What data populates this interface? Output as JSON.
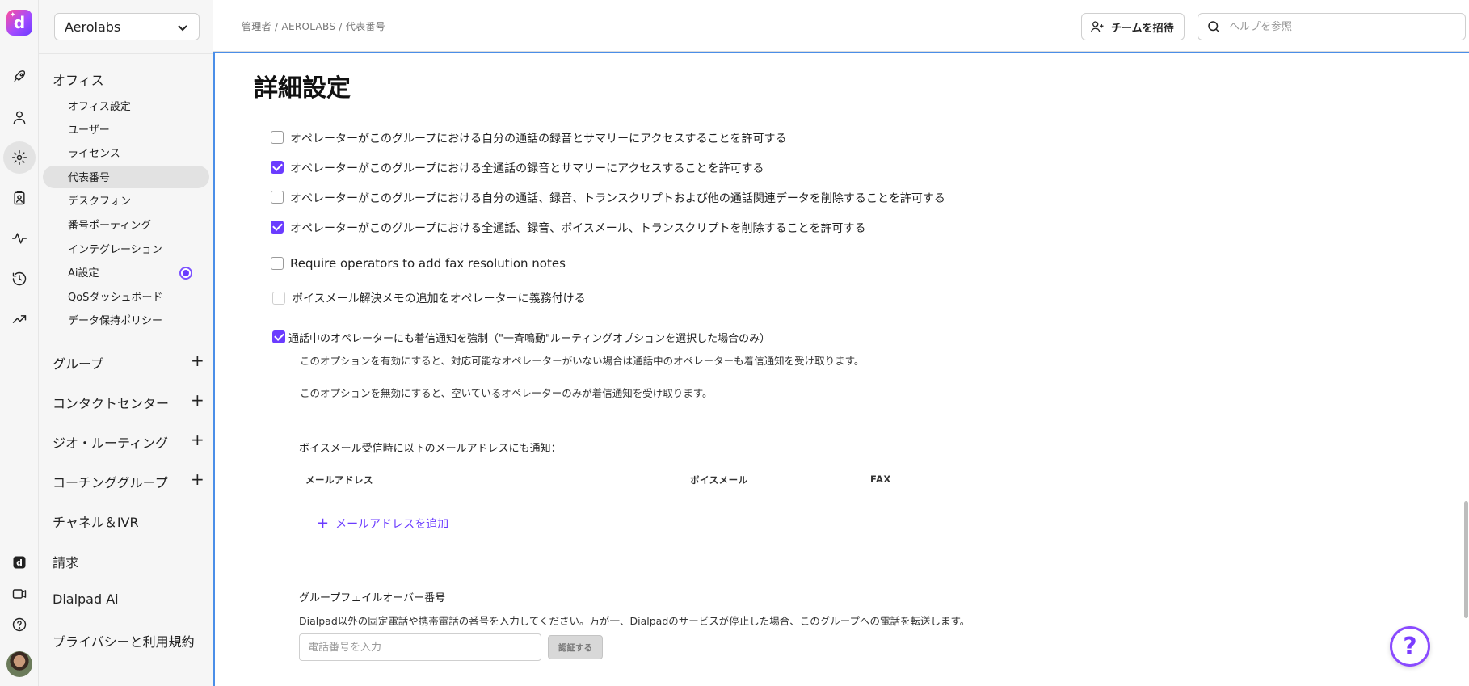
{
  "app": {
    "logo_letter": "d"
  },
  "sidebar": {
    "org_name": "Aerolabs",
    "sections": [
      {
        "label": "オフィス",
        "expanded": true
      },
      {
        "label": "グループ"
      },
      {
        "label": "コンタクトセンター"
      },
      {
        "label": "ジオ・ルーティング"
      },
      {
        "label": "コーチンググループ"
      },
      {
        "label": "チャネル＆IVR"
      },
      {
        "label": "請求"
      },
      {
        "label": "Dialpad Ai"
      },
      {
        "label": "プライバシーと利用規約"
      }
    ],
    "office_items": [
      "オフィス設定",
      "ユーザー",
      "ライセンス",
      "代表番号",
      "デスクフォン",
      "番号ポーティング",
      "インテグレーション",
      "Ai設定",
      "QoSダッシュボード",
      "データ保持ポリシー"
    ],
    "active_item": "代表番号"
  },
  "header": {
    "breadcrumb": "管理者 / AEROLABS / 代表番号",
    "invite_label": "チームを招待",
    "search_placeholder": "ヘルプを参照"
  },
  "main": {
    "title": "詳細設定",
    "options": [
      {
        "label": "オペレーターがこのグループにおける自分の通話の録音とサマリーにアクセスすることを許可する",
        "checked": false
      },
      {
        "label": "オペレーターがこのグループにおける全通話の録音とサマリーにアクセスすることを許可する",
        "checked": true
      },
      {
        "label": "オペレーターがこのグループにおける自分の通話、録音、トランスクリプトおよび他の通話関連データを削除することを許可する",
        "checked": false
      },
      {
        "label": "オペレーターがこのグループにおける全通話、録音、ボイスメール、トランスクリプトを削除することを許可する",
        "checked": true
      },
      {
        "label": "Require operators to add fax resolution notes",
        "checked": false
      },
      {
        "label": "ボイスメール解決メモの追加をオペレーターに義務付ける",
        "checked": false,
        "disabled": true
      },
      {
        "label": "通話中のオペレーターにも着信通知を強制（\"一斉鳴動\"ルーティングオプションを選択した場合のみ）",
        "checked": true
      }
    ],
    "ring_help_on": "このオプションを有効にすると、対応可能なオペレーターがいない場合は通話中のオペレーターも着信通知を受け取ります。",
    "ring_help_off": "このオプションを無効にすると、空いているオペレーターのみが着信通知を受け取ります。",
    "voicemail_notify": {
      "label": "ボイスメール受信時に以下のメールアドレスにも通知：",
      "columns": [
        "メールアドレス",
        "ボイスメール",
        "FAX"
      ],
      "add_label": "メールアドレスを追加"
    },
    "failover": {
      "label": "グループフェイルオーバー番号",
      "description": "Dialpad以外の固定電話や携帯電話の番号を入力してください。万が一、Dialpadのサービスが停止した場合、このグループへの電話を転送します。",
      "placeholder": "電話番号を入力",
      "verify_label": "認証する"
    }
  },
  "help_fab": "?"
}
